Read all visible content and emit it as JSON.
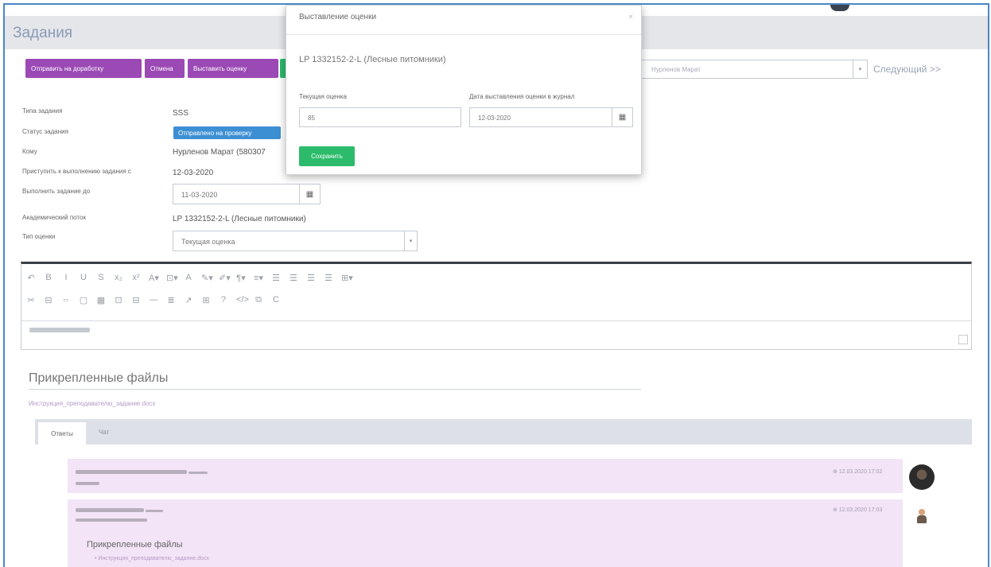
{
  "page": {
    "title": "Задания"
  },
  "toolbar": {
    "send_back": "Отправить на доработку",
    "cancel": "Отмена",
    "set_grade": "Выставить оценку",
    "next_select_placeholder": "Нурленов Марат",
    "next": "Следующий >>"
  },
  "fields": {
    "task_type": {
      "label": "Типа задания",
      "value": "SSS"
    },
    "task_status": {
      "label": "Статус задания",
      "value": "Отправлено на проверку"
    },
    "whom": {
      "label": "Кому",
      "value": "Нурленов Марат (580307"
    },
    "started": {
      "label": "Приступить к выполнению задания с",
      "value": "12-03-2020"
    },
    "due": {
      "label": "Выполнить задание до",
      "value": "11-03-2020"
    },
    "stream": {
      "label": "Академический поток",
      "value": "LP 1332152-2-L (Лесные питомники)"
    },
    "grade_type": {
      "label": "Тип оценки",
      "value": "Текущая оценка"
    }
  },
  "editor": {
    "row1": [
      "↶",
      "B",
      "I",
      "U",
      "S",
      "x₂",
      "x²",
      "A▾",
      "⊡▾",
      "A",
      "✎▾",
      "✐▾",
      "¶▾",
      "≡▾",
      "☰",
      "☰",
      "☰",
      "☰",
      "⊞▾"
    ],
    "row2": [
      "✂",
      "⊟",
      "⇔",
      "▢",
      "▦",
      "⊡",
      "⊟",
      "—",
      "≣",
      "↗",
      "⊞",
      "?",
      "</>",
      "⧉",
      "C"
    ]
  },
  "attachments": {
    "heading": "Прикрепленные файлы",
    "file": "Инструкция_преподавателю_задание.docx"
  },
  "tabs": {
    "answers": "Ответы",
    "chat": "Чат"
  },
  "messages": {
    "m1_time": "⊕ 12.03.2020 17:02",
    "m2_time": "⊕ 12.03.2020 17:03",
    "m2_files_label": "Прикрепленные файлы",
    "m2_file": "Инструкция_преподавателю_задание.docx"
  },
  "modal": {
    "title": "Выставление оценки",
    "close": "×",
    "subtitle": "LP 1332152-2-L (Лесные питомники)",
    "current_grade_label": "Текущая оценка",
    "date_label": "Дата выставления оценки в журнал",
    "grade_value": "85",
    "date_value": "12-03-2020",
    "save": "Сохранить"
  },
  "icons": {
    "calendar": "calendar-icon",
    "dropdown": "chevron-down-icon"
  },
  "colors": {
    "purple": "#9b49b5",
    "green": "#2bbb6a",
    "blue": "#3d8fd4",
    "message_bg": "#f3e4f7"
  }
}
